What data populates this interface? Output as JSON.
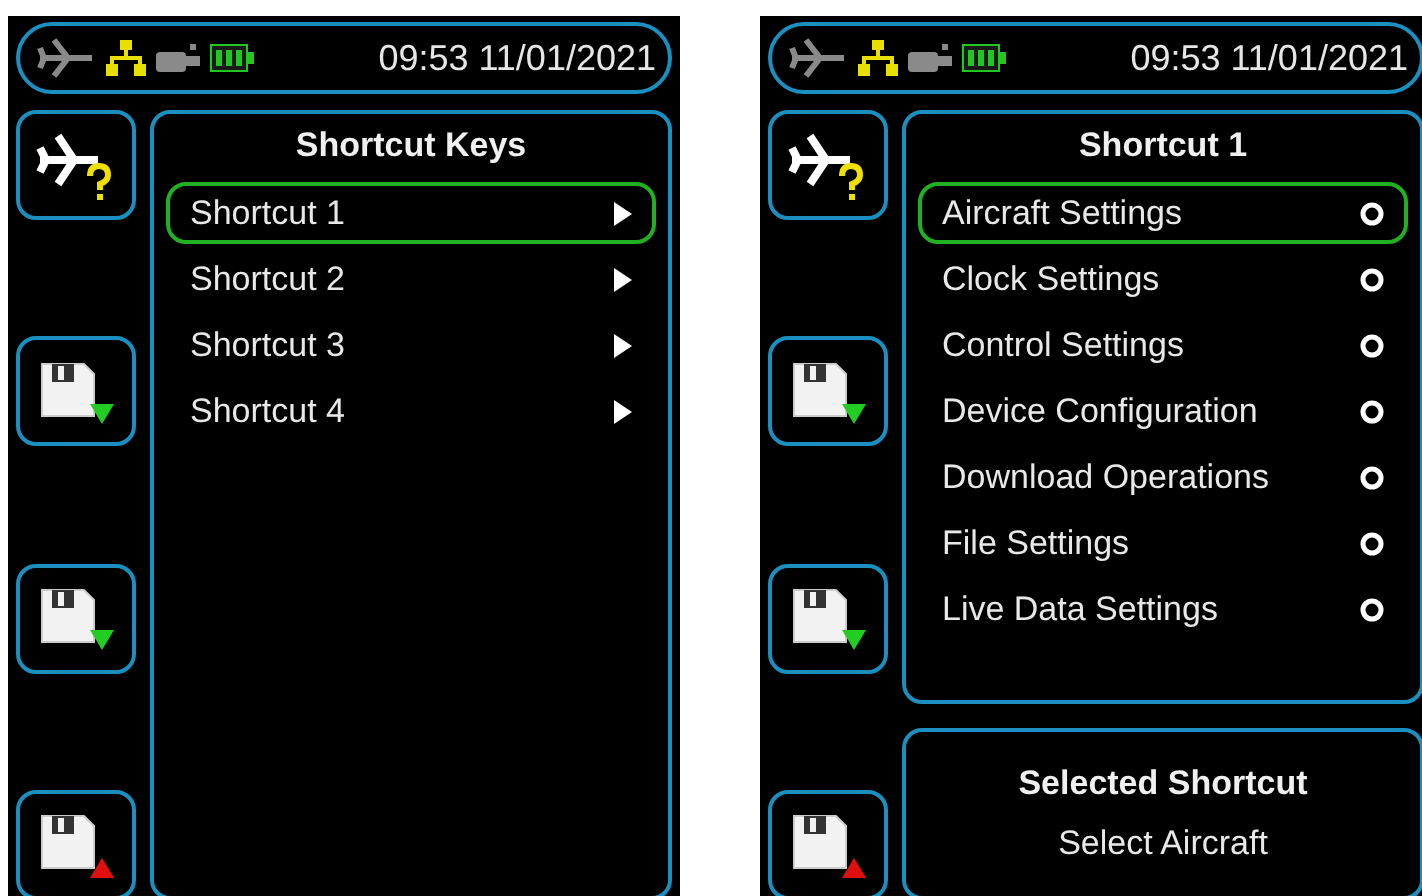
{
  "screens": [
    {
      "status_bar": {
        "time": "09:53 11/01/2021"
      },
      "side_buttons": [
        {
          "kind": "aircraft-help"
        },
        {
          "kind": "save-down"
        },
        {
          "kind": "save-down"
        },
        {
          "kind": "save-up"
        }
      ],
      "panel": {
        "title": "Shortcut Keys",
        "items": [
          {
            "label": "Shortcut 1",
            "kind": "submenu",
            "selected": true
          },
          {
            "label": "Shortcut 2",
            "kind": "submenu",
            "selected": false
          },
          {
            "label": "Shortcut 3",
            "kind": "submenu",
            "selected": false
          },
          {
            "label": "Shortcut 4",
            "kind": "submenu",
            "selected": false
          }
        ]
      }
    },
    {
      "status_bar": {
        "time": "09:53 11/01/2021"
      },
      "side_buttons": [
        {
          "kind": "aircraft-help"
        },
        {
          "kind": "save-down"
        },
        {
          "kind": "save-down"
        },
        {
          "kind": "save-up"
        }
      ],
      "panel": {
        "title": "Shortcut 1",
        "items": [
          {
            "label": "Aircraft Settings",
            "kind": "option",
            "selected": true
          },
          {
            "label": "Clock Settings",
            "kind": "option",
            "selected": false
          },
          {
            "label": "Control Settings",
            "kind": "option",
            "selected": false
          },
          {
            "label": "Device Configuration",
            "kind": "option",
            "selected": false
          },
          {
            "label": "Download Operations",
            "kind": "option",
            "selected": false
          },
          {
            "label": "File Settings",
            "kind": "option",
            "selected": false
          },
          {
            "label": "Live Data Settings",
            "kind": "option",
            "selected": false
          }
        ]
      },
      "info_panel": {
        "title": "Selected Shortcut",
        "value": "Select Aircraft"
      }
    }
  ]
}
